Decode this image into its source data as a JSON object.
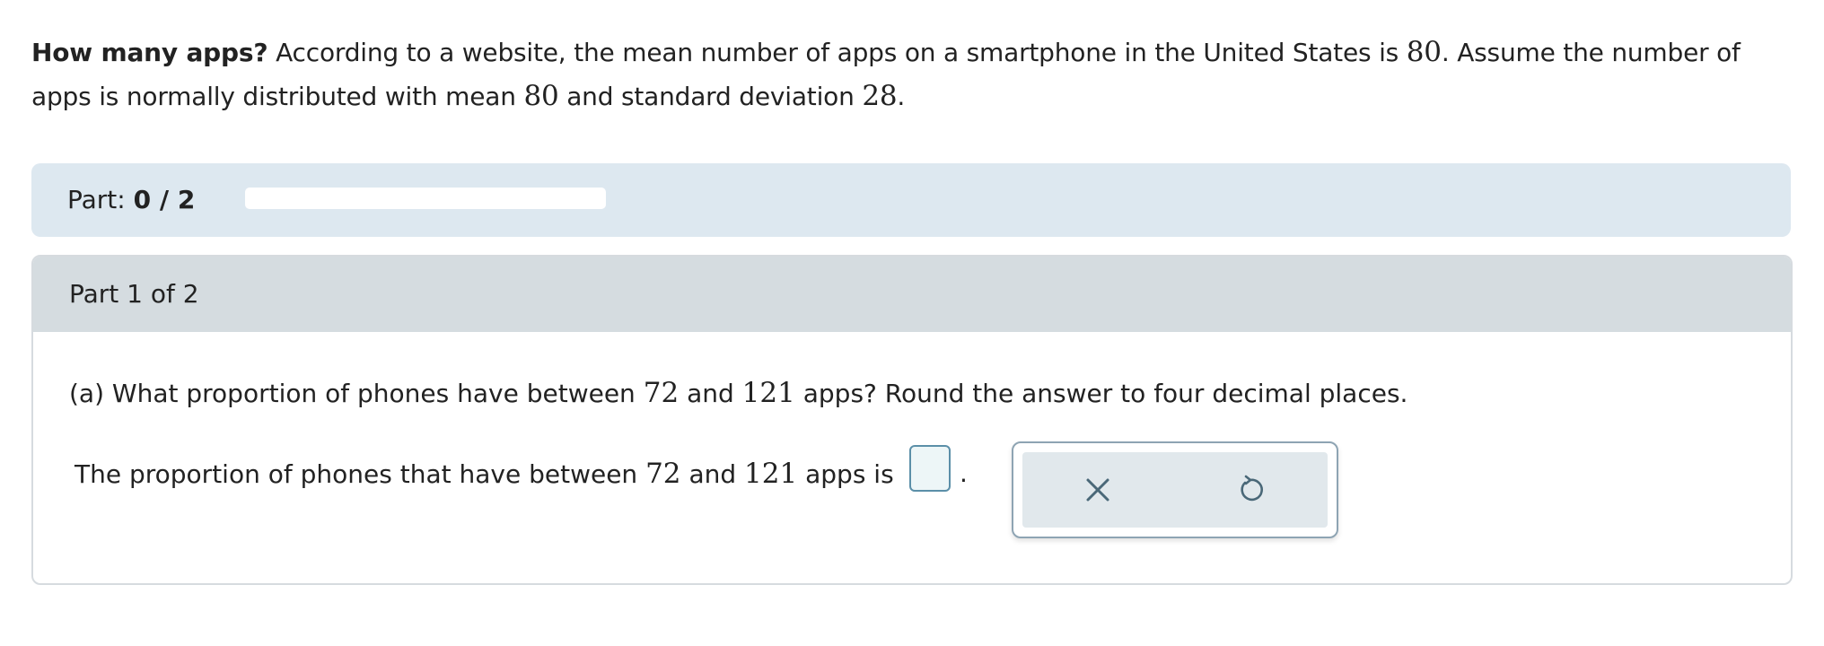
{
  "problem": {
    "title": "How many apps?",
    "text_1": "According to a website, the mean number of apps on a smartphone in the United States is",
    "mean_value": "80",
    "text_2": ". Assume the number of apps is normally distributed with mean",
    "mean_value_2": "80",
    "text_3": "and standard deviation",
    "sd_value": "28",
    "text_4": "."
  },
  "progress": {
    "label": "Part:",
    "count": "0 / 2",
    "fraction": 0
  },
  "part": {
    "header": "Part 1 of 2",
    "question_prefix": "(a) What proportion of phones have between",
    "question_low": "72",
    "question_and": "and",
    "question_high": "121",
    "question_suffix": "apps? Round the answer to four decimal places.",
    "answer_prefix": "The proportion of phones that have between",
    "answer_low": "72",
    "answer_and": "and",
    "answer_high": "121",
    "answer_suffix": "apps is",
    "answer_value": "",
    "period": "."
  },
  "tools": {
    "clear_icon": "x-icon",
    "undo_icon": "undo-icon"
  },
  "colors": {
    "progress_bar_bg": "#dde8f0",
    "part_header_bg": "#d5dce0",
    "input_border": "#5b8fa8",
    "icon_color": "#4a6878"
  }
}
